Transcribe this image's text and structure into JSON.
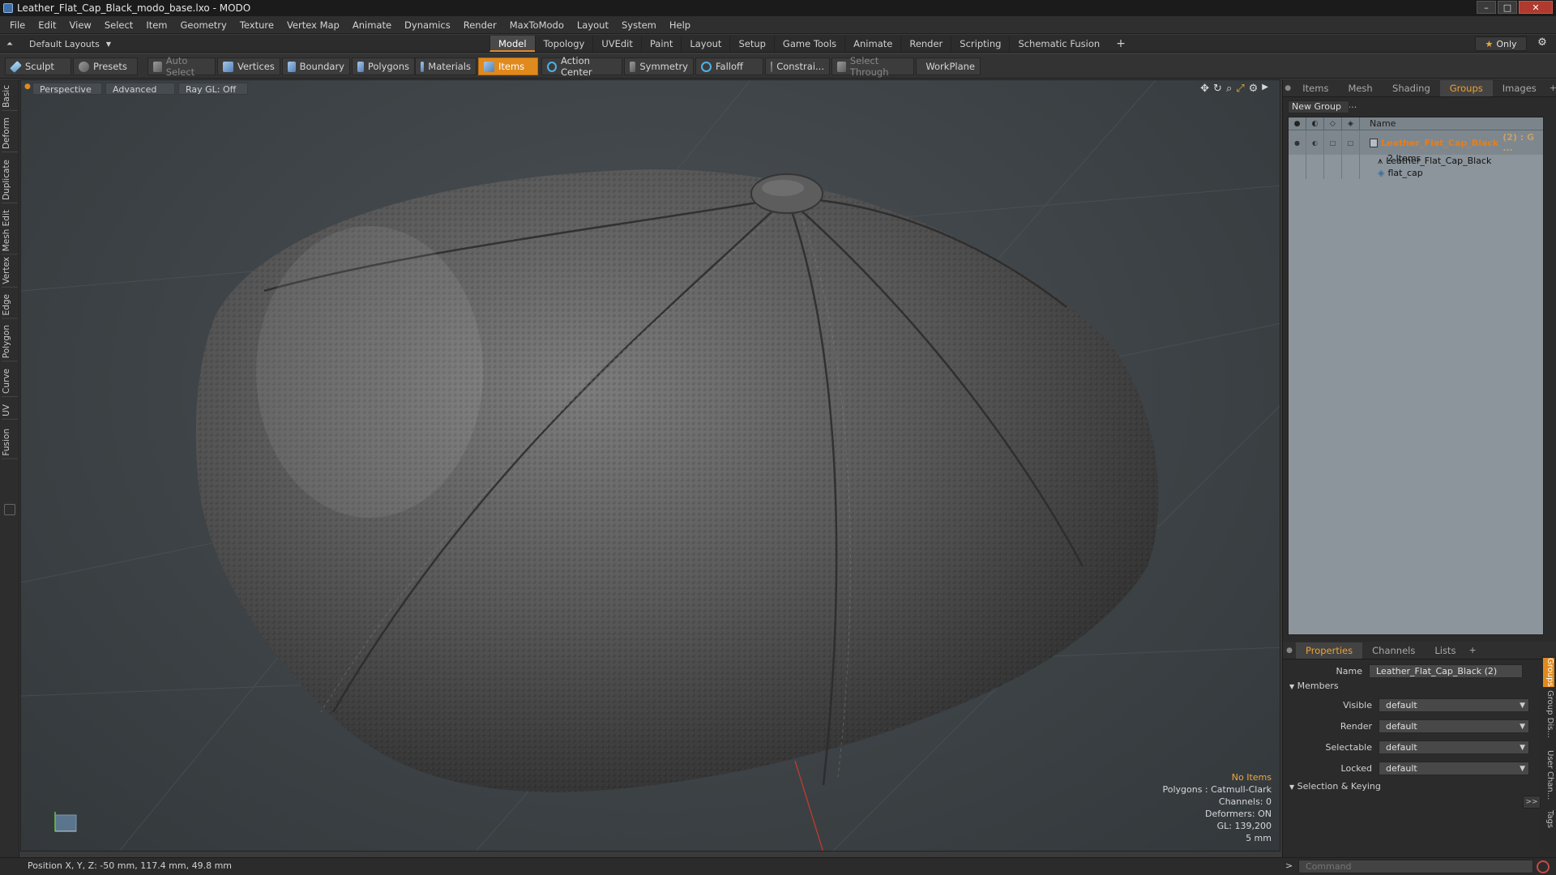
{
  "window": {
    "title": "Leather_Flat_Cap_Black_modo_base.lxo - MODO",
    "controls": {
      "minimize": "–",
      "maximize": "□",
      "close": "✕"
    }
  },
  "menu": [
    "File",
    "Edit",
    "View",
    "Select",
    "Item",
    "Geometry",
    "Texture",
    "Vertex Map",
    "Animate",
    "Dynamics",
    "Render",
    "MaxToModo",
    "Layout",
    "System",
    "Help"
  ],
  "layout": {
    "selector": "Default Layouts",
    "tabs": [
      "Model",
      "Topology",
      "UVEdit",
      "Paint",
      "Layout",
      "Setup",
      "Game Tools",
      "Animate",
      "Render",
      "Scripting",
      "Schematic Fusion"
    ],
    "active_tab": "Model",
    "add": "+",
    "only_label": "Only"
  },
  "toolbar": {
    "sculpt": "Sculpt",
    "presets": "Presets",
    "auto_select": "Auto Select",
    "vertices": "Vertices",
    "boundary": "Boundary",
    "polygons": "Polygons",
    "materials": "Materials",
    "items": "Items",
    "action_center": "Action Center",
    "symmetry": "Symmetry",
    "falloff": "Falloff",
    "constraints": "Constrai...",
    "select_through": "Select Through",
    "workplane": "WorkPlane"
  },
  "left_tabs": [
    "Basic",
    "Deform",
    "Duplicate",
    "Mesh Edit",
    "Vertex",
    "Edge",
    "Polygon",
    "Curve",
    "UV",
    "Fusion"
  ],
  "viewport": {
    "view": "Perspective",
    "shading": "Advanced",
    "raygl": "Ray GL: Off",
    "info": {
      "selection": "No Items",
      "polygons": "Polygons : Catmull-Clark",
      "channels": "Channels: 0",
      "deformers": "Deformers: ON",
      "gl": "GL: 139,200",
      "grid": "5 mm"
    }
  },
  "groups_panel": {
    "tabs": [
      "Items",
      "Mesh ...",
      "Shading",
      "Groups",
      "Images"
    ],
    "active_tab": "Groups",
    "new_group": "New Group",
    "column_name": "Name",
    "group": {
      "name": "Leather_Flat_Cap_Black",
      "suffix": "(2) : G ...",
      "count": "2 Items",
      "children": [
        "Leather_Flat_Cap_Black",
        "flat_cap"
      ]
    }
  },
  "properties": {
    "tabs": [
      "Properties",
      "Channels",
      "Lists"
    ],
    "active_tab": "Properties",
    "name_label": "Name",
    "name_value": "Leather_Flat_Cap_Black (2)",
    "members_section": "Members",
    "fields": [
      {
        "label": "Visible",
        "value": "default"
      },
      {
        "label": "Render",
        "value": "default"
      },
      {
        "label": "Selectable",
        "value": "default"
      },
      {
        "label": "Locked",
        "value": "default"
      }
    ],
    "selection_section": "Selection & Keying",
    "expand": ">>",
    "side_tabs": [
      "Groups",
      "Group Dis...",
      "User Chan...",
      "Tags"
    ]
  },
  "status": {
    "position": "Position X, Y, Z:  -50 mm, 117.4 mm, 49.8 mm",
    "command_placeholder": "Command",
    "prompt": ">"
  },
  "colors": {
    "accent": "#e08a1e",
    "viewport": "#3d4346",
    "group_list": "#8c959c"
  }
}
